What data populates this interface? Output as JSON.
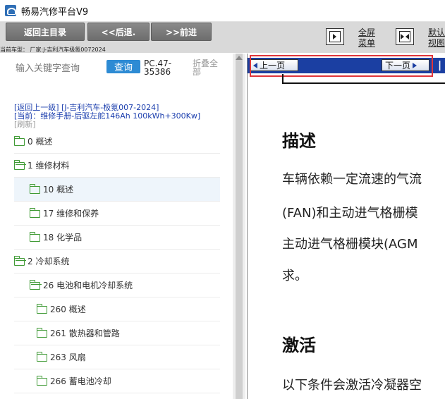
{
  "window": {
    "title": "畅易汽修平台V9"
  },
  "toolbar": {
    "back_main_label": "返回主目录",
    "back_label": "<<后退.",
    "forward_label": ">>前进",
    "vehicle_info": "当前车型： 厂家:J-吉利汽车极氪0072024",
    "fullscreen_label_1": "全屏",
    "fullscreen_label_2": "菜单",
    "default_view_label_1": "默认",
    "default_view_label_2": "视图"
  },
  "sidebar": {
    "search_placeholder": "输入关键字查询",
    "query_button": "查询",
    "pc_code": "PC.47-35386",
    "collapse_all": "折叠全部",
    "path": {
      "back_up": "[返回上一级]",
      "brand": "[J-吉利汽车-极氪007-2024]",
      "current": "[当前：维修手册-后驱左舵146Ah 100kWh+300Kw]",
      "refresh": "[刷新]"
    },
    "tree": [
      {
        "label": "0 概述",
        "level": 0,
        "selected": false
      },
      {
        "label": "1 维修材料",
        "level": 0,
        "selected": false
      },
      {
        "label": "10 概述",
        "level": 1,
        "selected": true
      },
      {
        "label": "17 维修和保养",
        "level": 1,
        "selected": false
      },
      {
        "label": "18 化学品",
        "level": 1,
        "selected": false
      },
      {
        "label": "2 冷却系统",
        "level": 0,
        "selected": false
      },
      {
        "label": "26 电池和电机冷却系统",
        "level": 1,
        "selected": false
      },
      {
        "label": "260 概述",
        "level": 2,
        "selected": false
      },
      {
        "label": "261 散热器和管路",
        "level": 2,
        "selected": false
      },
      {
        "label": "263 风扇",
        "level": 2,
        "selected": false
      },
      {
        "label": "266 蓄电池冷却",
        "level": 2,
        "selected": false
      }
    ]
  },
  "document": {
    "prev_page": "上一页",
    "next_page": "下一页",
    "heading_1": "描述",
    "lines_1": [
      "车辆依赖一定流速的气流",
      "(FAN)和主动进气格栅模",
      "主动进气格栅模块(AGM",
      "求。"
    ],
    "heading_2": "激活",
    "lines_2": [
      "以下条件会激活冷凝器空"
    ]
  },
  "colors": {
    "query_button": "#2d8bd4",
    "nav_strip": "#1b3fa2",
    "highlight": "#e0353a",
    "folder": "#3f9a35",
    "path_link": "#1c3fae"
  }
}
